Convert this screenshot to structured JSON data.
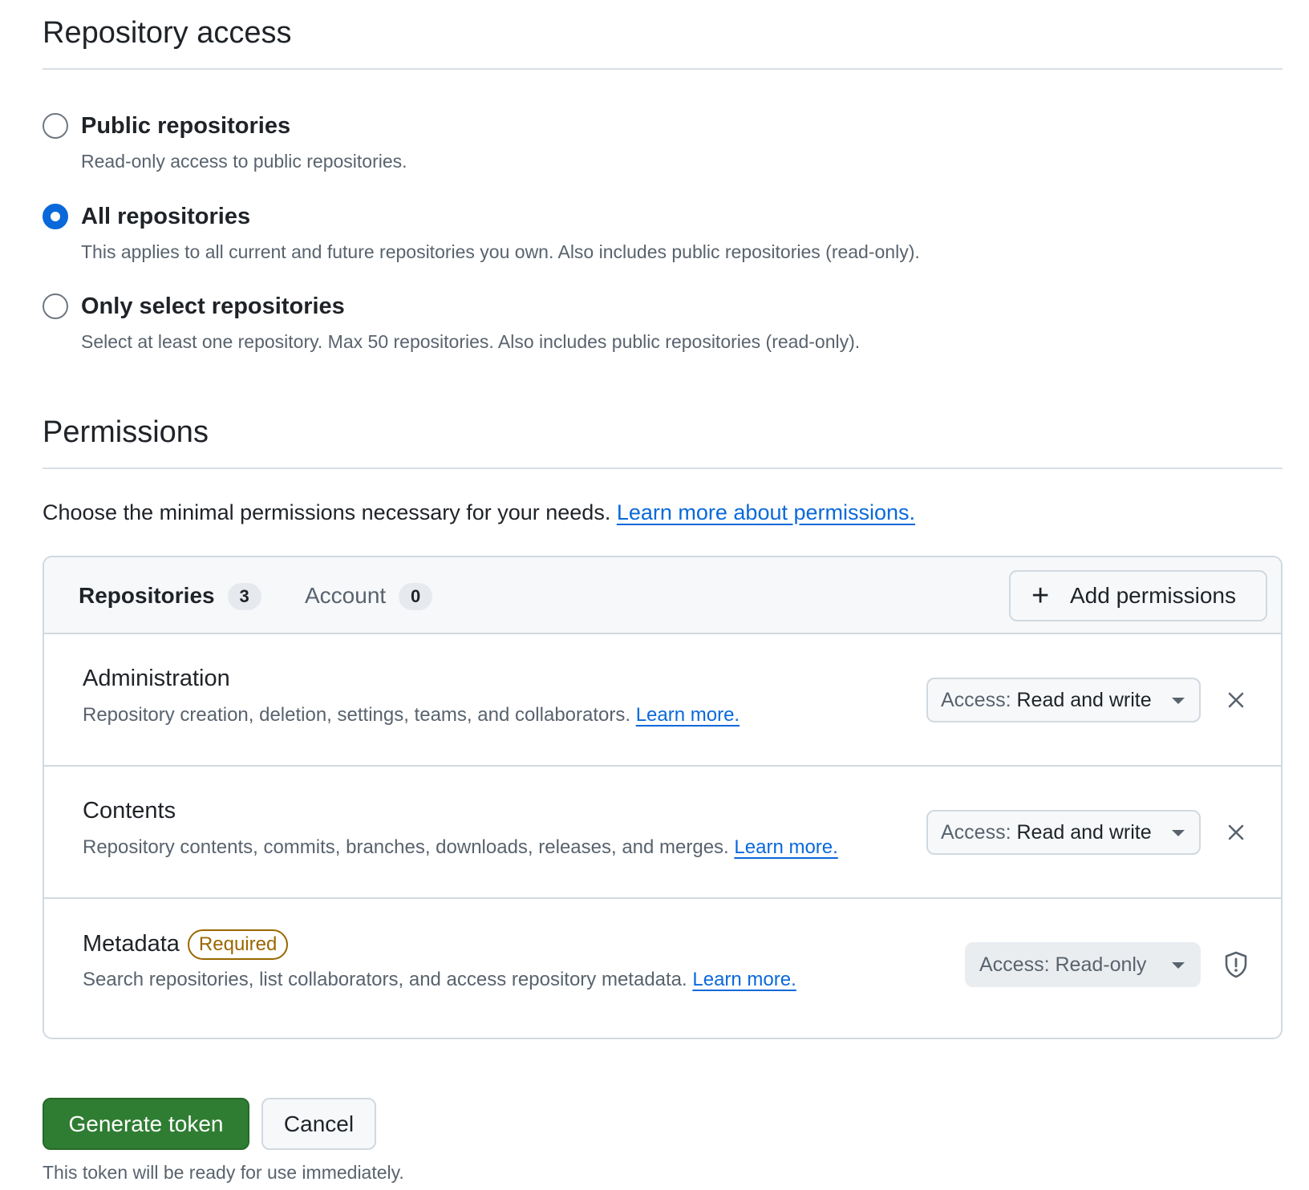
{
  "repository_access": {
    "title": "Repository access",
    "options": [
      {
        "label": "Public repositories",
        "description": "Read-only access to public repositories.",
        "checked": false
      },
      {
        "label": "All repositories",
        "description": "This applies to all current and future repositories you own. Also includes public repositories (read-only).",
        "checked": true
      },
      {
        "label": "Only select repositories",
        "description": "Select at least one repository. Max 50 repositories. Also includes public repositories (read-only).",
        "checked": false
      }
    ]
  },
  "permissions": {
    "title": "Permissions",
    "intro_text": "Choose the minimal permissions necessary for your needs.",
    "intro_link": "Learn more about permissions.",
    "tabs": [
      {
        "label": "Repositories",
        "count": "3",
        "active": true
      },
      {
        "label": "Account",
        "count": "0",
        "active": false
      }
    ],
    "add_button": {
      "icon": "plus-icon",
      "label": "Add permissions"
    },
    "items": [
      {
        "name": "Administration",
        "badge": "",
        "description": "Repository creation, deletion, settings, teams, and collaborators.",
        "link": "Learn more.",
        "access_prefix": "Access:",
        "access_value": "Read and write",
        "action_icon": "close-icon"
      },
      {
        "name": "Contents",
        "badge": "",
        "description": "Repository contents, commits, branches, downloads, releases, and merges.",
        "link": "Learn more.",
        "access_prefix": "Access:",
        "access_value": "Read and write",
        "action_icon": "close-icon"
      },
      {
        "name": "Metadata",
        "badge": "Required",
        "description": "Search repositories, list collaborators, and access repository metadata.",
        "link": "Learn more.",
        "access_prefix": "Access:",
        "access_value": "Read-only",
        "action_icon": "shield-icon"
      }
    ]
  },
  "actions": {
    "generate_label": "Generate token",
    "cancel_label": "Cancel",
    "footnote": "This token will be ready for use immediately."
  },
  "colors": {
    "accent": "#0969da",
    "primary_button": "#2f7d32",
    "required_badge": "#9a6700",
    "border": "#d1d9e0"
  }
}
